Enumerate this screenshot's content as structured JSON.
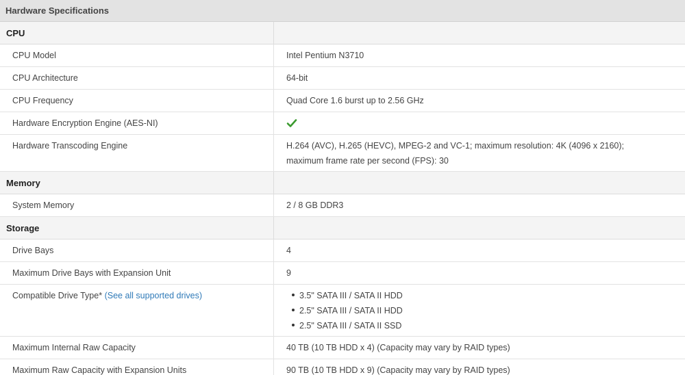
{
  "title": "Hardware Specifications",
  "sections": {
    "cpu": {
      "heading": "CPU",
      "rows": [
        {
          "label": "CPU Model",
          "value": "Intel Pentium N3710"
        },
        {
          "label": "CPU Architecture",
          "value": "64-bit"
        },
        {
          "label": "CPU Frequency",
          "value": "Quad Core 1.6 burst up to 2.56 GHz"
        },
        {
          "label": "Hardware Encryption Engine (AES-NI)",
          "value": ""
        },
        {
          "label": "Hardware Transcoding Engine",
          "value": "H.264 (AVC), H.265 (HEVC), MPEG-2 and VC-1; maximum resolution: 4K (4096 x 2160); maximum frame rate per second (FPS): 30"
        }
      ]
    },
    "memory": {
      "heading": "Memory",
      "rows": [
        {
          "label": "System Memory",
          "value": "2 / 8 GB DDR3"
        }
      ]
    },
    "storage": {
      "heading": "Storage",
      "rows": [
        {
          "label": "Drive Bays",
          "value": "4"
        },
        {
          "label": "Maximum Drive Bays with Expansion Unit",
          "value": "9"
        },
        {
          "label": "Compatible Drive Type*",
          "link": "(See all supported drives)",
          "items": [
            "3.5\" SATA III / SATA II HDD",
            "2.5\" SATA III / SATA II HDD",
            "2.5\" SATA III / SATA II SSD"
          ]
        },
        {
          "label": "Maximum Internal Raw Capacity",
          "value": "40 TB (10 TB HDD x 4) (Capacity may vary by RAID types)"
        },
        {
          "label": "Maximum Raw Capacity with Expansion Units",
          "value": "90 TB (10 TB HDD x 9) (Capacity may vary by RAID types)"
        }
      ]
    }
  },
  "colors": {
    "check": "#3a9a2e",
    "link": "#2f7ab8"
  },
  "icons": {
    "aes_supported": "checkmark-icon"
  }
}
